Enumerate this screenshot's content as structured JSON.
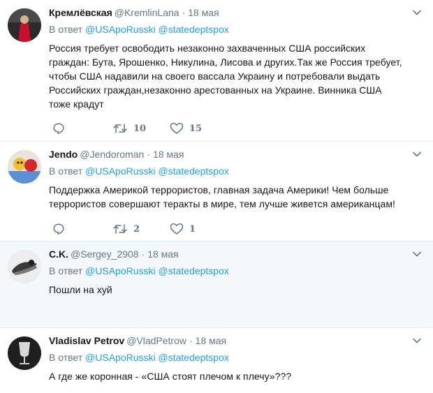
{
  "reply_prefix": "В ответ",
  "tweets": [
    {
      "name": "Кремлёвская",
      "handle": "@KremlinLana",
      "time": "18 мая",
      "mentions": [
        "@USApoRusski",
        "@statedeptspox"
      ],
      "text": "Россия требует освободить незаконно захваченных США российских граждан: Бута, Ярошенко, Никулина, Лисова и других.Так же Россия требует, чтобы США надавили на своего вассала Украину и потребовали выдать Российских граждан,незаконно арестованных на Украине. Винника США тоже крадут",
      "retweets": "10",
      "likes": "15"
    },
    {
      "name": "Jendo",
      "handle": "@Jendoroman",
      "time": "18 мая",
      "mentions": [
        "@USApoRusski",
        "@statedeptspox"
      ],
      "text": "Поддержка Америкой террористов, главная задача Америки! Чем больше террористов совершают теракты в мире, тем лучше живется американцам!",
      "retweets": "2",
      "likes": "1"
    },
    {
      "name": "C.K.",
      "handle": "@Sergey_2908",
      "time": "18 мая",
      "mentions": [
        "@USApoRusski",
        "@statedeptspox"
      ],
      "text": "Пошли на хуй"
    },
    {
      "name": "Vladislav Petrov",
      "handle": "@VladPetrow",
      "time": "18 мая",
      "mentions": [
        "@USApoRusski",
        "@statedeptspox"
      ],
      "text": "А где же коронная - «США стоят плечом к плечу»???"
    }
  ],
  "colors": {
    "accent": "#1da1f2",
    "secondary_text": "#657786",
    "divider": "#e6ecf0",
    "highlight_bg": "#f5f8fa"
  }
}
